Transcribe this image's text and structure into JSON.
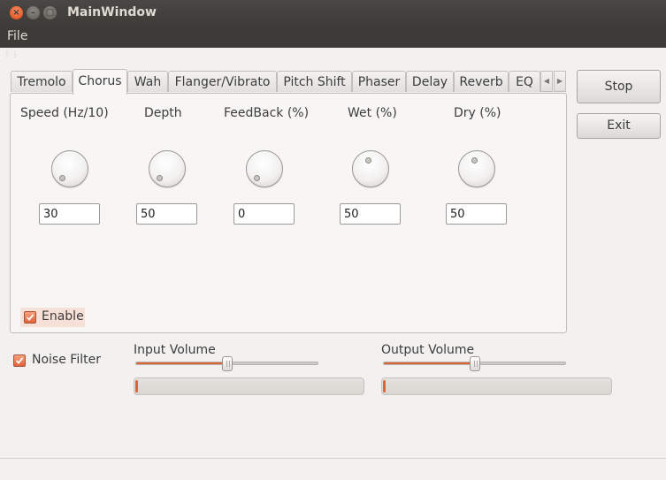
{
  "window": {
    "title": "MainWindow"
  },
  "menu": {
    "items": [
      "File"
    ]
  },
  "tabs": [
    "Tremolo",
    "Chorus",
    "Wah",
    "Flanger/Vibrato",
    "Pitch Shift",
    "Phaser",
    "Delay",
    "Reverb",
    "EQ"
  ],
  "active_tab": "Chorus",
  "chorus": {
    "params": [
      {
        "label": "Speed (Hz/10)",
        "value": "30"
      },
      {
        "label": "Depth",
        "value": "50"
      },
      {
        "label": "FeedBack (%)",
        "value": "0"
      },
      {
        "label": "Wet (%)",
        "value": "50"
      },
      {
        "label": "Dry (%)",
        "value": "50"
      }
    ],
    "enable": {
      "label": "Enable",
      "checked": true
    }
  },
  "buttons": {
    "stop": "Stop",
    "exit": "Exit"
  },
  "noise_filter": {
    "label": "Noise Filter",
    "checked": true
  },
  "input_volume": {
    "label": "Input Volume",
    "level": 0.5,
    "meter_level": 0.01
  },
  "output_volume": {
    "label": "Output Volume",
    "level": 0.5,
    "meter_level": 0.01
  },
  "colors": {
    "accent": "#e0643a",
    "titlebar": "#3c3b37",
    "background": "#f2f1f0"
  }
}
